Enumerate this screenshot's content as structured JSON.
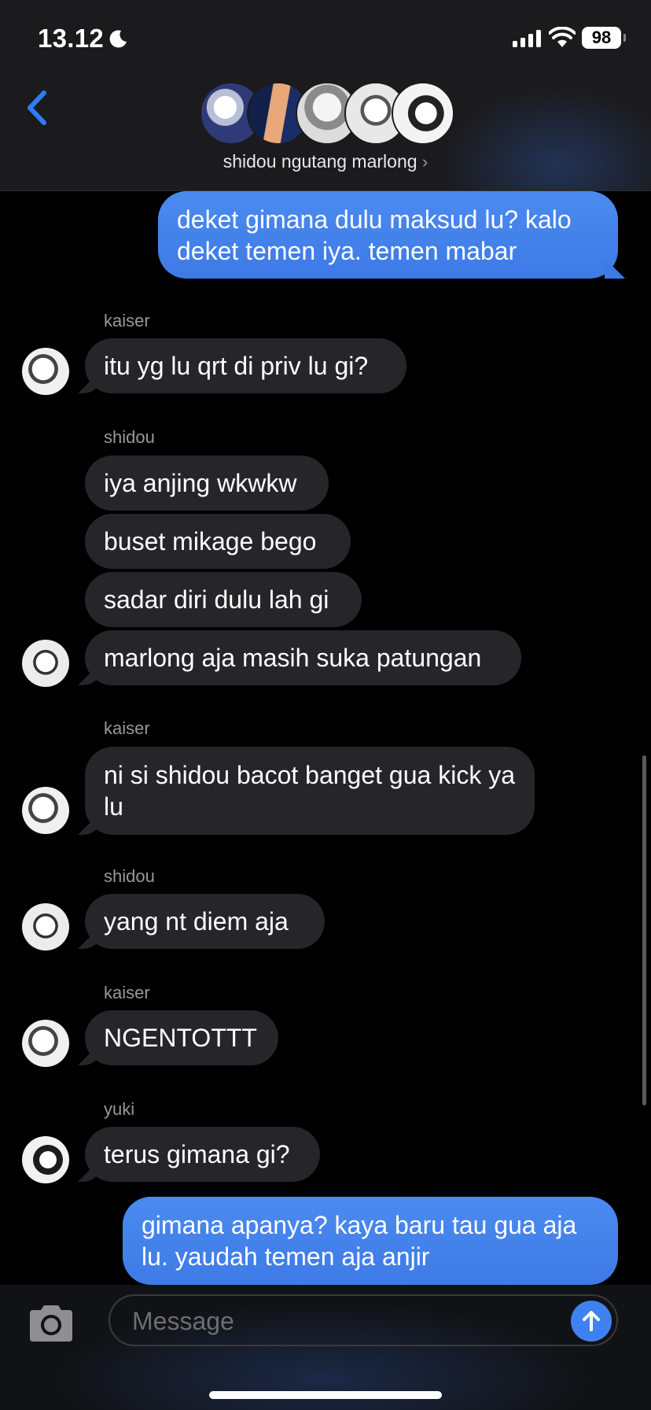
{
  "status": {
    "time": "13.12",
    "battery": "98"
  },
  "header": {
    "group_name": "shidou ngutang marlong",
    "chevron": "›"
  },
  "messages": {
    "m1": "deket gimana dulu maksud lu? kalo deket temen iya. temen mabar",
    "kaiser": "kaiser",
    "m2": "itu yg lu qrt di priv lu gi?",
    "shidou": "shidou",
    "m3": "iya anjing wkwkw",
    "m4": "buset mikage bego",
    "m5": "sadar diri dulu lah gi",
    "m6": "marlong aja masih suka patungan",
    "m7": "ni si shidou bacot banget gua kick ya lu",
    "m8": "yang nt diem aja",
    "m9": "NGENTOTTT",
    "yuki": "yuki",
    "m10": "terus gimana gi?",
    "m11": "gimana apanya? kaya baru tau gua aja lu. yaudah temen aja anjir"
  },
  "composer": {
    "placeholder": "Message"
  },
  "colors": {
    "outgoing": "#3e7ae6",
    "incoming": "#26262a",
    "accent": "#2f7cf6"
  },
  "icons": [
    "moon-icon",
    "signal-icon",
    "wifi-icon",
    "back-chevron-icon",
    "camera-icon",
    "send-arrow-icon"
  ]
}
